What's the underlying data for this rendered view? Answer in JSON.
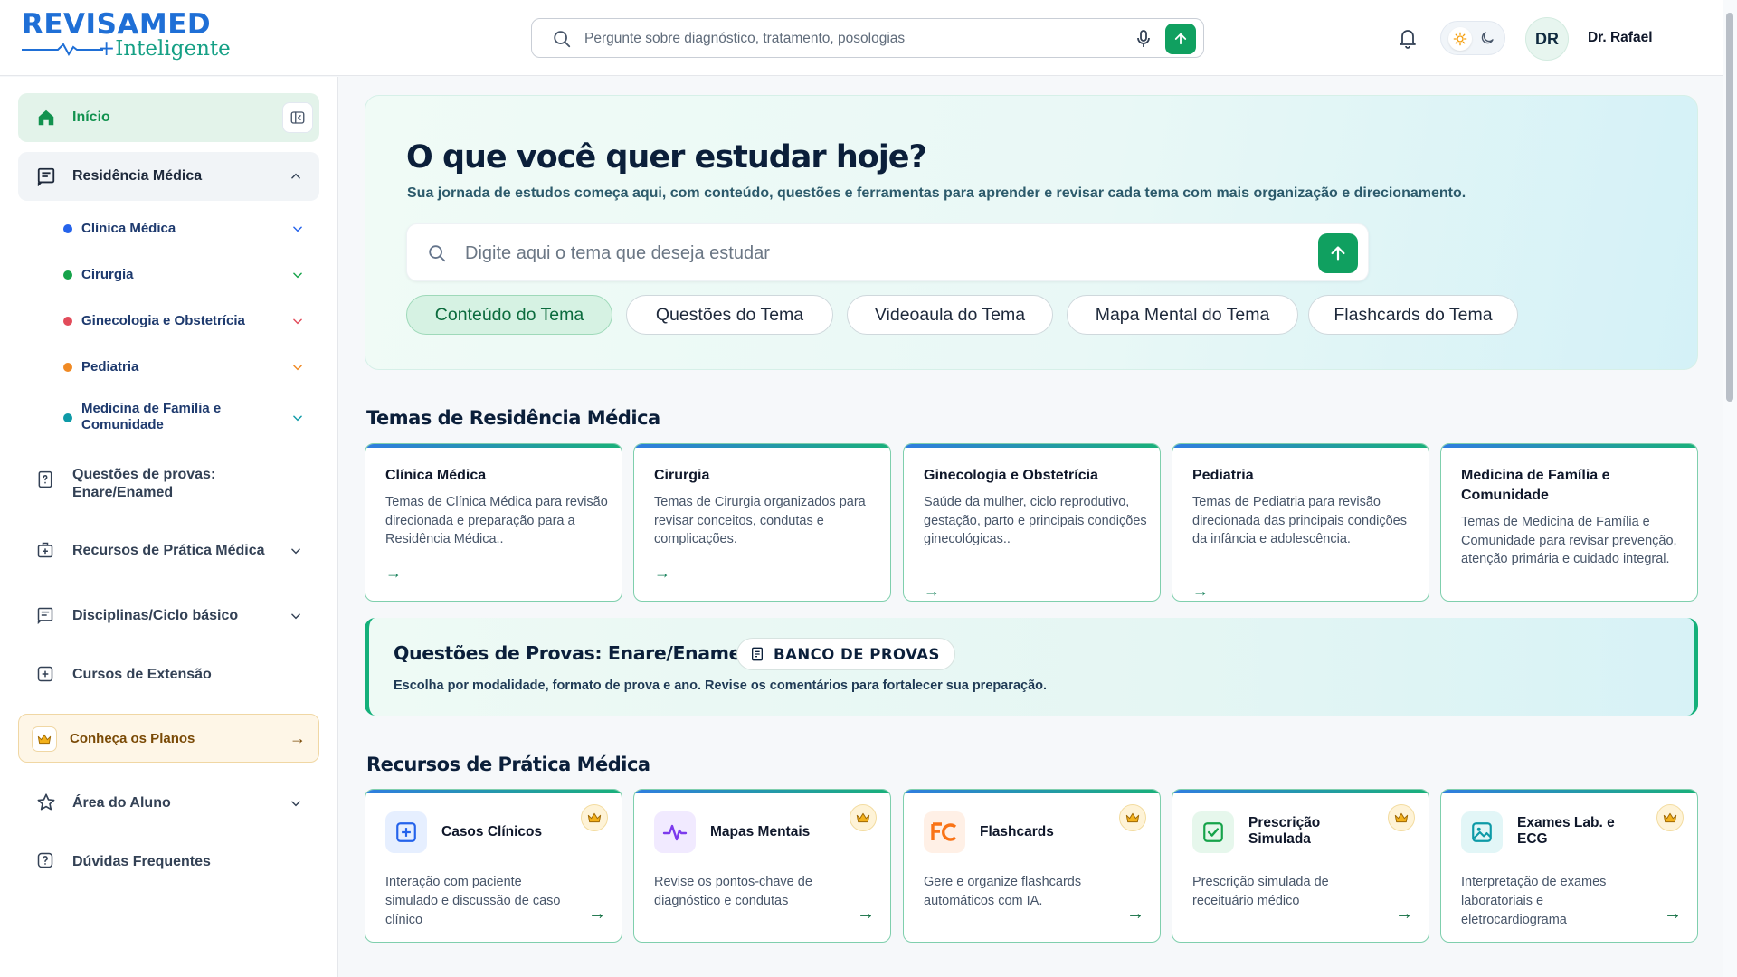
{
  "header": {
    "logo_top": "REVISAMED",
    "logo_bottom": "Inteligente",
    "search_placeholder": "Pergunte sobre diagnóstico, tratamento, posologias",
    "avatar_initials": "DR",
    "user_name": "Dr. Rafael"
  },
  "sidebar": {
    "home_label": "Início",
    "residencia_label": "Residência Médica",
    "sub_items": [
      {
        "label": "Clínica Médica",
        "color": "#2563eb"
      },
      {
        "label": "Cirurgia",
        "color": "#16a34a"
      },
      {
        "label": "Ginecologia e Obstetrícia",
        "color": "#e24b5a"
      },
      {
        "label": "Pediatria",
        "color": "#f08a24"
      },
      {
        "label": "Medicina de Família e Comunidade",
        "color": "#0e9aa7"
      }
    ],
    "questoes_label": "Questões de provas: Enare/Enamed",
    "recursos_label": "Recursos de Prática Médica",
    "disciplinas_label": "Disciplinas/Ciclo básico",
    "cursos_label": "Cursos de Extensão",
    "planos_label": "Conheça os Planos",
    "planos_arrow": "→",
    "aluno_label": "Área do Aluno",
    "duvidas_label": "Dúvidas Frequentes"
  },
  "hero": {
    "title": "O que você quer estudar hoje?",
    "subtitle": "Sua jornada de estudos começa aqui, com conteúdo, questões e ferramentas para aprender e revisar cada tema com mais organização e direcionamento.",
    "search_placeholder": "Digite aqui o tema que deseja estudar",
    "pills": [
      "Conteúdo do Tema",
      "Questões do Tema",
      "Videoaula do Tema",
      "Mapa Mental do Tema",
      "Flashcards do Tema"
    ]
  },
  "temas": {
    "title": "Temas de Residência Médica",
    "cards": [
      {
        "title": "Clínica Médica",
        "desc": "Temas de Clínica Médica para revisão direcionada e preparação para a Residência Médica..",
        "arrow": "→"
      },
      {
        "title": "Cirurgia",
        "desc": "Temas de Cirurgia organizados para revisar conceitos, condutas e complicações.",
        "arrow": "→"
      },
      {
        "title": "Ginecologia e Obstetrícia",
        "desc": "Saúde da mulher, ciclo reprodutivo, gestação, parto e principais condições ginecológicas..",
        "arrow": "→"
      },
      {
        "title": "Pediatria",
        "desc": "Temas de Pediatria para revisão direcionada das principais condições da infância e adolescência.",
        "arrow": "→"
      },
      {
        "title": "Medicina de Família e Comunidade",
        "desc": "Temas de Medicina de Família e Comunidade para revisar prevenção, atenção primária e cuidado integral.",
        "arrow": ""
      }
    ]
  },
  "banco": {
    "title": "Questões de Provas: Enare/Enamed",
    "badge": "BANCO DE PROVAS",
    "desc": "Escolha por modalidade, formato de prova e ano. Revise os comentários para fortalecer sua preparação."
  },
  "recursos": {
    "title": "Recursos de Prática Médica",
    "cards": [
      {
        "title": "Casos Clínicos",
        "desc": "Interação com paciente simulado e discussão de caso clínico",
        "arrow": "→",
        "icon": "plus-square-icon",
        "color": "#2563eb"
      },
      {
        "title": "Mapas Mentais",
        "desc": "Revise os pontos-chave de diagnóstico e condutas",
        "arrow": "→",
        "icon": "pulse-icon",
        "color": "#7c3aed"
      },
      {
        "title": "Flashcards",
        "desc": "Gere e organize flashcards automáticos com IA.",
        "arrow": "→",
        "icon": "fc-icon",
        "color": "#f97316"
      },
      {
        "title": "Prescrição Simulada",
        "desc": "Prescrição simulada de receituário médico",
        "arrow": "→",
        "icon": "checkbox-icon",
        "color": "#16a34a"
      },
      {
        "title": "Exames Lab. e ECG",
        "desc": "Interpretação de exames laboratoriais e eletrocardiograma",
        "arrow": "→",
        "icon": "image-icon",
        "color": "#0e9aa7"
      }
    ]
  }
}
